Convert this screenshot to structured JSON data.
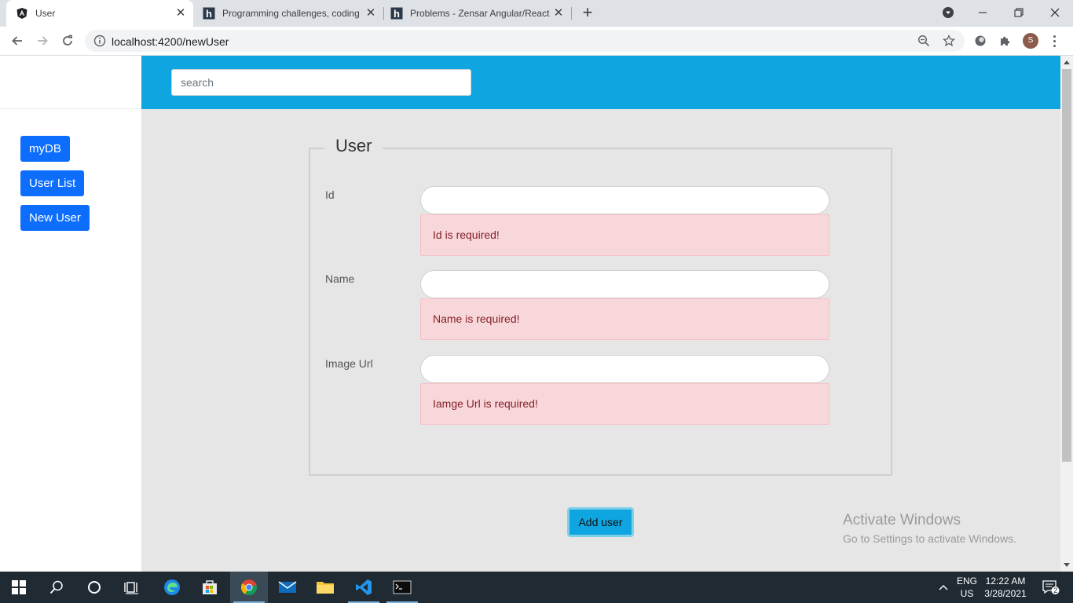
{
  "browser": {
    "tabs": [
      {
        "title": "User",
        "active": true
      },
      {
        "title": "Programming challenges, coding",
        "active": false
      },
      {
        "title": "Problems - Zensar Angular/React",
        "active": false
      }
    ],
    "url": "localhost:4200/newUser",
    "profile_initial": "S"
  },
  "sidebar": {
    "items": [
      {
        "label": "myDB"
      },
      {
        "label": "User List"
      },
      {
        "label": "New User"
      }
    ]
  },
  "header": {
    "search_placeholder": "search"
  },
  "form": {
    "legend": "User",
    "fields": [
      {
        "label": "Id",
        "value": "",
        "error": "Id is required!"
      },
      {
        "label": "Name",
        "value": "",
        "error": "Name is required!"
      },
      {
        "label": "Image Url",
        "value": "",
        "error": "Iamge Url is required!"
      }
    ],
    "submit_label": "Add user"
  },
  "watermark": {
    "line1": "Activate Windows",
    "line2": "Go to Settings to activate Windows."
  },
  "taskbar": {
    "lang_line1": "ENG",
    "lang_line2": "US",
    "time": "12:22 AM",
    "date": "3/28/2021",
    "notification_count": "2"
  },
  "colors": {
    "header": "#0ea5e0",
    "nav_button": "#0d6efd",
    "error_bg": "#f8d7da",
    "error_text": "#842029",
    "main_bg": "#e6e6e6"
  }
}
